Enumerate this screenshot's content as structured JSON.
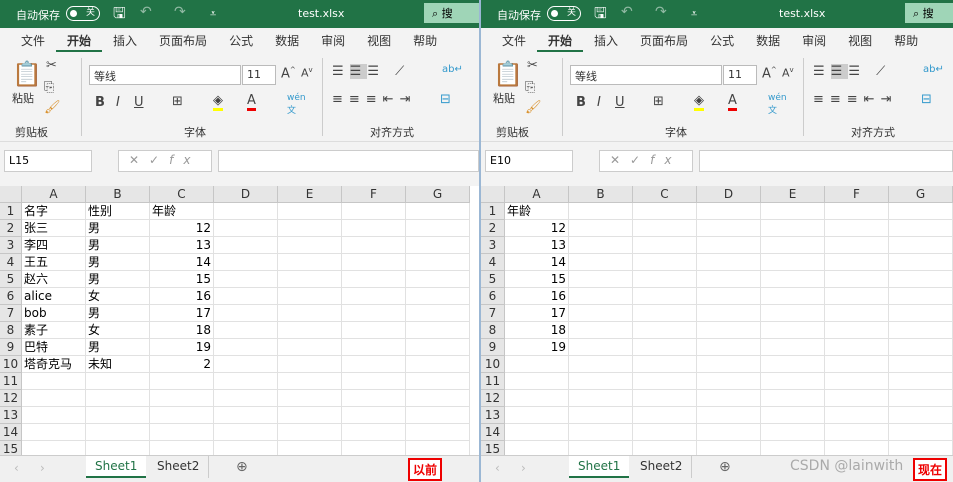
{
  "panes": [
    {
      "title": {
        "autosave": "自动保存",
        "toggle": "关",
        "filename": "test.xlsx",
        "search": "搜"
      },
      "tabs": [
        "文件",
        "开始",
        "插入",
        "页面布局",
        "公式",
        "数据",
        "审阅",
        "视图",
        "帮助"
      ],
      "ribbon": {
        "paste": "粘贴",
        "clipboard": "剪贴板",
        "font_name": "等线",
        "font_size": "11",
        "font": "字体",
        "alignment": "对齐方式"
      },
      "namebox": "L15",
      "fx": "fx",
      "columns": [
        "A",
        "B",
        "C",
        "D",
        "E",
        "F",
        "G"
      ],
      "rows": [
        [
          "名字",
          "性别",
          "年龄"
        ],
        [
          "张三",
          "男",
          12
        ],
        [
          "李四",
          "男",
          13
        ],
        [
          "王五",
          "男",
          14
        ],
        [
          "赵六",
          "男",
          15
        ],
        [
          "alice",
          "女",
          16
        ],
        [
          "bob",
          "男",
          17
        ],
        [
          "素子",
          "女",
          18
        ],
        [
          "巴特",
          "男",
          19
        ],
        [
          "塔奇克马",
          "未知",
          2
        ],
        [],
        [],
        [],
        [],
        []
      ],
      "sheets": [
        "Sheet1",
        "Sheet2"
      ],
      "label": "以前"
    },
    {
      "title": {
        "autosave": "自动保存",
        "toggle": "关",
        "filename": "test.xlsx",
        "search": "搜"
      },
      "tabs": [
        "文件",
        "开始",
        "插入",
        "页面布局",
        "公式",
        "数据",
        "审阅",
        "视图",
        "帮助"
      ],
      "ribbon": {
        "paste": "粘贴",
        "clipboard": "剪贴板",
        "font_name": "等线",
        "font_size": "11",
        "font": "字体",
        "alignment": "对齐方式"
      },
      "namebox": "E10",
      "fx": "fx",
      "columns": [
        "A",
        "B",
        "C",
        "D",
        "E",
        "F",
        "G"
      ],
      "rows": [
        [
          "年龄"
        ],
        [
          12
        ],
        [
          13
        ],
        [
          14
        ],
        [
          15
        ],
        [
          16
        ],
        [
          17
        ],
        [
          18
        ],
        [
          19
        ],
        [],
        [],
        [],
        [],
        [],
        []
      ],
      "sheets": [
        "Sheet1",
        "Sheet2"
      ],
      "label": "现在"
    }
  ],
  "watermark": "CSDN @lainwith"
}
